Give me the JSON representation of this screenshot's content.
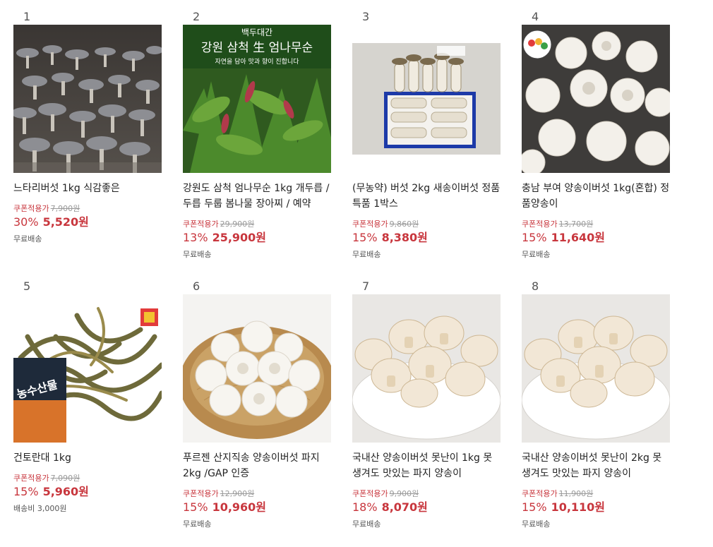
{
  "products": [
    {
      "rank": "1",
      "title": "느타리버섯 1kg 식감좋은",
      "coupon_label": "쿠폰적용가",
      "original_price": "7,900원",
      "discount": "30%",
      "price": "5,520원",
      "shipping": "무료배송",
      "image": "oyster-mushroom-farm"
    },
    {
      "rank": "2",
      "title": "강원도 삼척 엄나무순 1kg 개두릅 / 두릅 두룹 봄나물 장아찌 / 예약",
      "coupon_label": "쿠폰적용가",
      "original_price": "29,900원",
      "discount": "13%",
      "price": "25,900원",
      "shipping": "무료배송",
      "image": "wild-greens",
      "image_text": {
        "top": "백두대간",
        "main": "강원 삼척 生 엄나무순",
        "sub": "자연을 담아 맛과 향이 진합니다"
      }
    },
    {
      "rank": "3",
      "title": "(무농약) 버섯 2kg 새송이버섯 정품 특품 1박스",
      "coupon_label": "쿠폰적용가",
      "original_price": "9,860원",
      "discount": "15%",
      "price": "8,380원",
      "shipping": "무료배송",
      "image": "king-oyster-box"
    },
    {
      "rank": "4",
      "title": "충남 부여 양송이버섯 1kg(혼합) 정품양송이",
      "coupon_label": "쿠폰적용가",
      "original_price": "13,700원",
      "discount": "15%",
      "price": "11,640원",
      "shipping": "무료배송",
      "image": "white-mushrooms-good-logo"
    },
    {
      "rank": "5",
      "title": "건토란대 1kg",
      "coupon_label": "쿠폰적용가",
      "original_price": "7,090원",
      "discount": "15%",
      "price": "5,960원",
      "shipping": "배송비 3,000원",
      "image": "dried-taro-stems",
      "image_text": {
        "badge": "농수산물"
      }
    },
    {
      "rank": "6",
      "title": "푸르젠 산지직송 양송이버섯 파지 2kg /GAP 인증",
      "coupon_label": "쿠폰적용가",
      "original_price": "12,900원",
      "discount": "15%",
      "price": "10,960원",
      "shipping": "무료배송",
      "image": "mushrooms-basket"
    },
    {
      "rank": "7",
      "title": "국내산 양송이버섯 못난이 1kg 못생겨도 맛있는 파지 양송이",
      "coupon_label": "쿠폰적용가",
      "original_price": "9,900원",
      "discount": "18%",
      "price": "8,070원",
      "shipping": "무료배송",
      "image": "mushrooms-bowl"
    },
    {
      "rank": "8",
      "title": "국내산 양송이버섯 못난이 2kg 못생겨도 맛있는 파지 양송이",
      "coupon_label": "쿠폰적용가",
      "original_price": "11,900원",
      "discount": "15%",
      "price": "10,110원",
      "shipping": "무료배송",
      "image": "mushrooms-bowl"
    }
  ],
  "colors": {
    "price": "#c8363d",
    "original": "#999999",
    "text": "#222222",
    "muted": "#555555"
  }
}
